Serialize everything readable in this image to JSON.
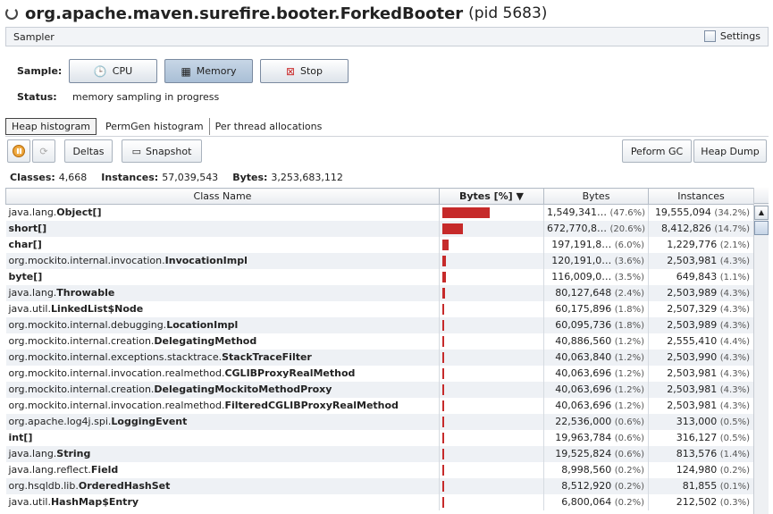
{
  "header": {
    "app_name": "org.apache.maven.surefire.booter.ForkedBooter",
    "pid": "(pid 5683)"
  },
  "sampler": {
    "title": "Sampler",
    "settings_label": "Settings"
  },
  "sample": {
    "label": "Sample:",
    "cpu": "CPU",
    "memory": "Memory",
    "stop": "Stop"
  },
  "status": {
    "label": "Status:",
    "value": "memory sampling in progress"
  },
  "tabs": [
    "Heap histogram",
    "PermGen histogram",
    "Per thread allocations"
  ],
  "toolbar": {
    "deltas": "Deltas",
    "snapshot": "Snapshot",
    "gc": "Peform GC",
    "heap_dump": "Heap Dump"
  },
  "summary": {
    "classes_label": "Classes:",
    "classes": "4,668",
    "instances_label": "Instances:",
    "instances": "57,039,543",
    "bytes_label": "Bytes:",
    "bytes": "3,253,683,112"
  },
  "columns": {
    "name": "Class Name",
    "bytes_pct": "Bytes [%]",
    "bytes": "Bytes",
    "instances": "Instances"
  },
  "rows": [
    {
      "pkg": "java.lang.",
      "cls": "Object[]",
      "pct": 47.6,
      "bytes": "1,549,341…",
      "bp": "(47.6%)",
      "inst": "19,555,094",
      "ip": "(34.2%)"
    },
    {
      "pkg": "",
      "cls": "short[]",
      "pct": 20.6,
      "bytes": "672,770,8…",
      "bp": "(20.6%)",
      "inst": "8,412,826",
      "ip": "(14.7%)"
    },
    {
      "pkg": "",
      "cls": "char[]",
      "pct": 6.0,
      "bytes": "197,191,8…",
      "bp": "(6.0%)",
      "inst": "1,229,776",
      "ip": "(2.1%)"
    },
    {
      "pkg": "org.mockito.internal.invocation.",
      "cls": "InvocationImpl",
      "pct": 3.6,
      "bytes": "120,191,0…",
      "bp": "(3.6%)",
      "inst": "2,503,981",
      "ip": "(4.3%)"
    },
    {
      "pkg": "",
      "cls": "byte[]",
      "pct": 3.5,
      "bytes": "116,009,0…",
      "bp": "(3.5%)",
      "inst": "649,843",
      "ip": "(1.1%)"
    },
    {
      "pkg": "java.lang.",
      "cls": "Throwable",
      "pct": 2.4,
      "bytes": "80,127,648",
      "bp": "(2.4%)",
      "inst": "2,503,989",
      "ip": "(4.3%)"
    },
    {
      "pkg": "java.util.",
      "cls": "LinkedList$Node",
      "pct": 1.8,
      "bytes": "60,175,896",
      "bp": "(1.8%)",
      "inst": "2,507,329",
      "ip": "(4.3%)"
    },
    {
      "pkg": "org.mockito.internal.debugging.",
      "cls": "LocationImpl",
      "pct": 1.8,
      "bytes": "60,095,736",
      "bp": "(1.8%)",
      "inst": "2,503,989",
      "ip": "(4.3%)"
    },
    {
      "pkg": "org.mockito.internal.creation.",
      "cls": "DelegatingMethod",
      "pct": 1.2,
      "bytes": "40,886,560",
      "bp": "(1.2%)",
      "inst": "2,555,410",
      "ip": "(4.4%)"
    },
    {
      "pkg": "org.mockito.internal.exceptions.stacktrace.",
      "cls": "StackTraceFilter",
      "pct": 1.2,
      "bytes": "40,063,840",
      "bp": "(1.2%)",
      "inst": "2,503,990",
      "ip": "(4.3%)"
    },
    {
      "pkg": "org.mockito.internal.invocation.realmethod.",
      "cls": "CGLIBProxyRealMethod",
      "pct": 1.2,
      "bytes": "40,063,696",
      "bp": "(1.2%)",
      "inst": "2,503,981",
      "ip": "(4.3%)"
    },
    {
      "pkg": "org.mockito.internal.creation.",
      "cls": "DelegatingMockitoMethodProxy",
      "pct": 1.2,
      "bytes": "40,063,696",
      "bp": "(1.2%)",
      "inst": "2,503,981",
      "ip": "(4.3%)"
    },
    {
      "pkg": "org.mockito.internal.invocation.realmethod.",
      "cls": "FilteredCGLIBProxyRealMethod",
      "pct": 1.2,
      "bytes": "40,063,696",
      "bp": "(1.2%)",
      "inst": "2,503,981",
      "ip": "(4.3%)"
    },
    {
      "pkg": "org.apache.log4j.spi.",
      "cls": "LoggingEvent",
      "pct": 0.6,
      "bytes": "22,536,000",
      "bp": "(0.6%)",
      "inst": "313,000",
      "ip": "(0.5%)"
    },
    {
      "pkg": "",
      "cls": "int[]",
      "pct": 0.6,
      "bytes": "19,963,784",
      "bp": "(0.6%)",
      "inst": "316,127",
      "ip": "(0.5%)"
    },
    {
      "pkg": "java.lang.",
      "cls": "String",
      "pct": 0.6,
      "bytes": "19,525,824",
      "bp": "(0.6%)",
      "inst": "813,576",
      "ip": "(1.4%)"
    },
    {
      "pkg": "java.lang.reflect.",
      "cls": "Field",
      "pct": 0.2,
      "bytes": "8,998,560",
      "bp": "(0.2%)",
      "inst": "124,980",
      "ip": "(0.2%)"
    },
    {
      "pkg": "org.hsqldb.lib.",
      "cls": "OrderedHashSet",
      "pct": 0.2,
      "bytes": "8,512,920",
      "bp": "(0.2%)",
      "inst": "81,855",
      "ip": "(0.1%)"
    },
    {
      "pkg": "java.util.",
      "cls": "HashMap$Entry",
      "pct": 0.2,
      "bytes": "6,800,064",
      "bp": "(0.2%)",
      "inst": "212,502",
      "ip": "(0.3%)"
    }
  ]
}
